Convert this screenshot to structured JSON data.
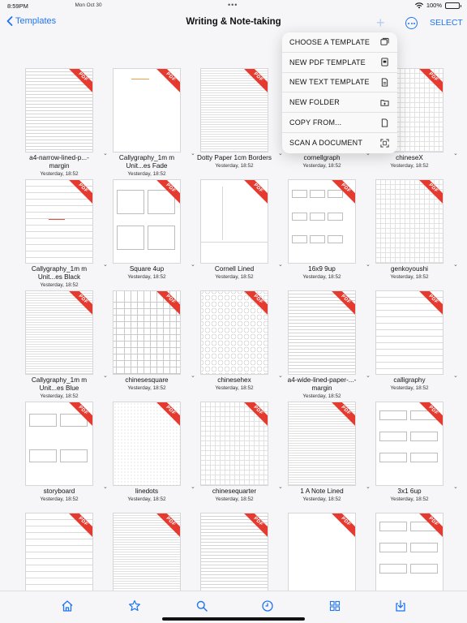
{
  "status": {
    "time": "8:59PM",
    "date": "Mon Oct 30",
    "battery": "100%"
  },
  "nav": {
    "back_label": "Templates",
    "title": "Writing & Note-taking",
    "select_label": "SELECT",
    "add_icon": "plus-icon",
    "more_icon": "more-circle-icon"
  },
  "menu": {
    "items": [
      {
        "label": "CHOOSE A TEMPLATE",
        "icon": "template-icon"
      },
      {
        "label": "NEW PDF TEMPLATE",
        "icon": "pdf-doc-icon"
      },
      {
        "label": "NEW TEXT TEMPLATE",
        "icon": "text-doc-icon"
      },
      {
        "label": "NEW FOLDER",
        "icon": "folder-add-icon"
      },
      {
        "label": "COPY FROM...",
        "icon": "doc-icon"
      },
      {
        "label": "SCAN A DOCUMENT",
        "icon": "scan-icon"
      }
    ]
  },
  "pdf_badge": "PDF",
  "templates": [
    {
      "name": "a4-narrow-lined-p...-margin",
      "date": "Yesterday, 18:52",
      "pattern": "lined"
    },
    {
      "name": "Callygraphy_1m m Unit...es Fade",
      "date": "Yesterday, 18:52",
      "pattern": "blank-orange"
    },
    {
      "name": "Dotty Paper 1cm Borders",
      "date": "Yesterday, 18:52",
      "pattern": "fine"
    },
    {
      "name": "cornellgraph",
      "date": "Yesterday, 18:52",
      "pattern": "grid"
    },
    {
      "name": "chineseX",
      "date": "Yesterday, 18:52",
      "pattern": "grid"
    },
    {
      "name": "Callygraphy_1m m Unit...es Black",
      "date": "Yesterday, 18:52",
      "pattern": "calli-black"
    },
    {
      "name": "Square 4up",
      "date": "Yesterday, 18:52",
      "pattern": "four-up"
    },
    {
      "name": "Cornell Lined",
      "date": "Yesterday, 18:52",
      "pattern": "cornell"
    },
    {
      "name": "16x9 9up",
      "date": "Yesterday, 18:52",
      "pattern": "nine-up"
    },
    {
      "name": "genkoyoushi",
      "date": "Yesterday, 18:52",
      "pattern": "grid"
    },
    {
      "name": "Callygraphy_1m m Unit...es Blue",
      "date": "Yesterday, 18:52",
      "pattern": "fine"
    },
    {
      "name": "chinesesquare",
      "date": "Yesterday, 18:52",
      "pattern": "squares"
    },
    {
      "name": "chinesehex",
      "date": "Yesterday, 18:52",
      "pattern": "hex"
    },
    {
      "name": "a4-wide-lined-paper-...-margin",
      "date": "Yesterday, 18:52",
      "pattern": "lined"
    },
    {
      "name": "calligraphy",
      "date": "Yesterday, 18:52",
      "pattern": "wide"
    },
    {
      "name": "storyboard",
      "date": "Yesterday, 18:52",
      "pattern": "storyboard"
    },
    {
      "name": "linedots",
      "date": "Yesterday, 18:52",
      "pattern": "dots"
    },
    {
      "name": "chinesequarter",
      "date": "Yesterday, 18:52",
      "pattern": "grid"
    },
    {
      "name": "1 A Note Lined",
      "date": "Yesterday, 18:52",
      "pattern": "fine"
    },
    {
      "name": "3x1 6up",
      "date": "Yesterday, 18:52",
      "pattern": "six-up"
    },
    {
      "name": "",
      "date": "",
      "pattern": "wide"
    },
    {
      "name": "",
      "date": "",
      "pattern": "fine"
    },
    {
      "name": "",
      "date": "",
      "pattern": "lined"
    },
    {
      "name": "",
      "date": "",
      "pattern": "blank"
    },
    {
      "name": "",
      "date": "",
      "pattern": "six-up"
    }
  ],
  "tabbar": {
    "tabs": [
      {
        "icon": "home-icon"
      },
      {
        "icon": "star-icon"
      },
      {
        "icon": "search-icon"
      },
      {
        "icon": "clock-icon"
      },
      {
        "icon": "grid-icon"
      },
      {
        "icon": "download-icon"
      }
    ]
  },
  "colors": {
    "accent": "#1d74f5",
    "pdf_badge": "#e53a30",
    "background": "#f6f6f8"
  }
}
